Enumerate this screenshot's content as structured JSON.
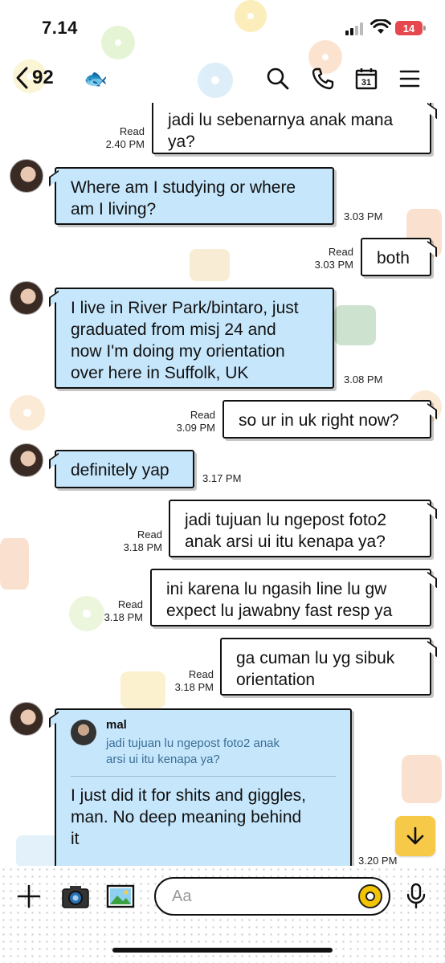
{
  "status_bar": {
    "time": "7.14",
    "battery": "14"
  },
  "header": {
    "unread_count": "92",
    "contact_emoji": "🐟"
  },
  "icons": {
    "back": "chevron-left-icon",
    "search": "search-icon",
    "call": "phone-icon",
    "calendar": "calendar-icon",
    "calendar_day": "31",
    "menu": "menu-icon",
    "plus": "plus-icon",
    "camera": "camera-icon",
    "gallery": "image-icon",
    "emoji": "emoji-icon",
    "mic": "microphone-icon",
    "scroll": "arrow-down-icon"
  },
  "messages": [
    {
      "dir": "out",
      "lines": [
        "jadi lu sebenarnya anak mana",
        "ya?"
      ],
      "read": "Read",
      "time": "2.40 PM"
    },
    {
      "dir": "in",
      "lines": [
        "Where am I studying or where",
        "am I living?"
      ],
      "time": "3.03 PM"
    },
    {
      "dir": "out",
      "lines": [
        "both"
      ],
      "read": "Read",
      "time": "3.03 PM"
    },
    {
      "dir": "in",
      "lines": [
        "I live in River Park/bintaro, just",
        "graduated from misj 24 and",
        "now I'm doing my orientation",
        "over here in Suffolk, UK"
      ],
      "time": "3.08 PM"
    },
    {
      "dir": "out",
      "lines": [
        "so ur in uk right now?"
      ],
      "read": "Read",
      "time": "3.09 PM"
    },
    {
      "dir": "in",
      "lines": [
        "definitely yap"
      ],
      "time": "3.17 PM"
    },
    {
      "dir": "out",
      "lines": [
        "jadi tujuan lu ngepost foto2",
        "anak arsi ui itu kenapa ya?"
      ],
      "read": "Read",
      "time": "3.18 PM"
    },
    {
      "dir": "out",
      "lines": [
        "ini karena lu ngasih line lu gw",
        "expect lu jawabny fast resp ya"
      ],
      "read": "Read",
      "time": "3.18 PM"
    },
    {
      "dir": "out",
      "lines": [
        "ga cuman lu yg sibuk",
        "orientation"
      ],
      "read": "Read",
      "time": "3.18 PM"
    },
    {
      "dir": "in",
      "reply_sender": "mal",
      "reply_lines": [
        "jadi tujuan lu ngepost foto2 anak",
        "arsi ui itu kenapa ya?"
      ],
      "lines": [
        "I just did it for shits and giggles,",
        "man. No deep meaning behind",
        "it"
      ],
      "time": "3.20 PM"
    }
  ],
  "input": {
    "placeholder": "Aa"
  },
  "colors": {
    "incoming": "#c6e6fb",
    "outgoing": "#ffffff",
    "accent": "#f7c948"
  }
}
